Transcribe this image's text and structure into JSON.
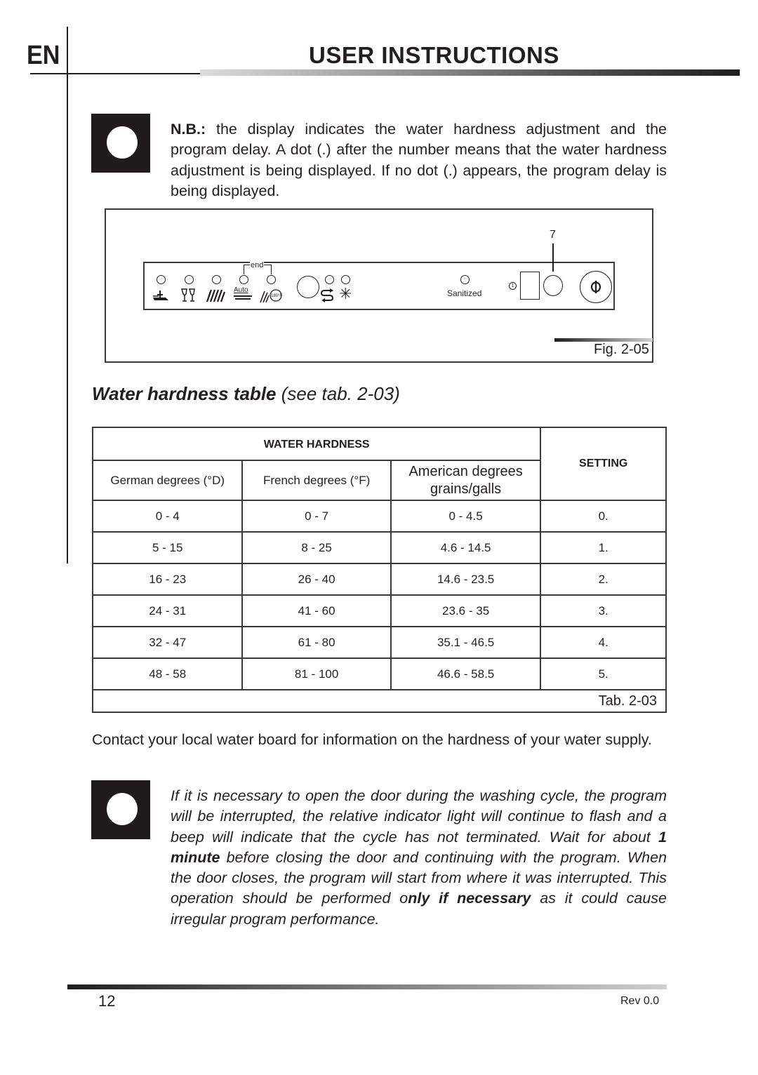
{
  "header": {
    "language": "EN",
    "title": "USER INSTRUCTIONS"
  },
  "note1": {
    "icon": "note-circle-icon",
    "label": "N.B.:",
    "text": " the display indicates the water hardness adjustment and the program delay. A dot (.) after the number means that the water hardness adjustment is being displayed. If no dot (.) appears, the program delay is being displayed."
  },
  "figure": {
    "callout_number": "7",
    "end_label": "end",
    "sanitized_label": "Sanitized",
    "auto_label": "Auto",
    "temp_label": "180°F",
    "caption": "Fig. 2-05",
    "program_icons": [
      "pots-pans-icon",
      "glasses-icon",
      "rinse-icon",
      "auto-wash-icon",
      "sanitize-wash-icon"
    ],
    "option_icons": [
      "half-load-icon",
      "rinse-aid-icon"
    ]
  },
  "section": {
    "title_bold": "Water hardness table",
    "title_ref": " (see tab. 2-03)"
  },
  "table": {
    "group_header": "WATER HARDNESS",
    "setting_header": "SETTING",
    "col_headers": [
      "German degrees (°D)",
      "French degrees (°F)",
      "American degrees grains/galls"
    ],
    "rows": [
      [
        "0 - 4",
        "0 - 7",
        "0 - 4.5",
        "0."
      ],
      [
        "5 - 15",
        "8 - 25",
        "4.6 - 14.5",
        "1."
      ],
      [
        "16 - 23",
        "26 - 40",
        "14.6 - 23.5",
        "2."
      ],
      [
        "24 - 31",
        "41 - 60",
        "23.6 - 35",
        "3."
      ],
      [
        "32 - 47",
        "61 - 80",
        "35.1 - 46.5",
        "4."
      ],
      [
        "48 - 58",
        "81 - 100",
        "46.6 - 58.5",
        "5."
      ]
    ],
    "caption": "Tab. 2-03"
  },
  "contact_text": "Contact your local water board for information on the hardness of your water supply.",
  "note2": {
    "icon": "note-circle-icon",
    "part1": "If it is necessary to open the door during the washing cycle, the program will be interrupted, the relative indicator light will continue to flash and a beep will indicate that the cycle has not terminated. Wait for about ",
    "bold1": "1 minute",
    "part2": " before closing the door and continuing with the program. When the door closes, the program will start from where it was interrupted. This operation should be performed o",
    "bold2": "nly if necessary",
    "part3": " as it could cause irregular program performance."
  },
  "footer": {
    "page_number": "12",
    "revision": "Rev 0.0"
  }
}
